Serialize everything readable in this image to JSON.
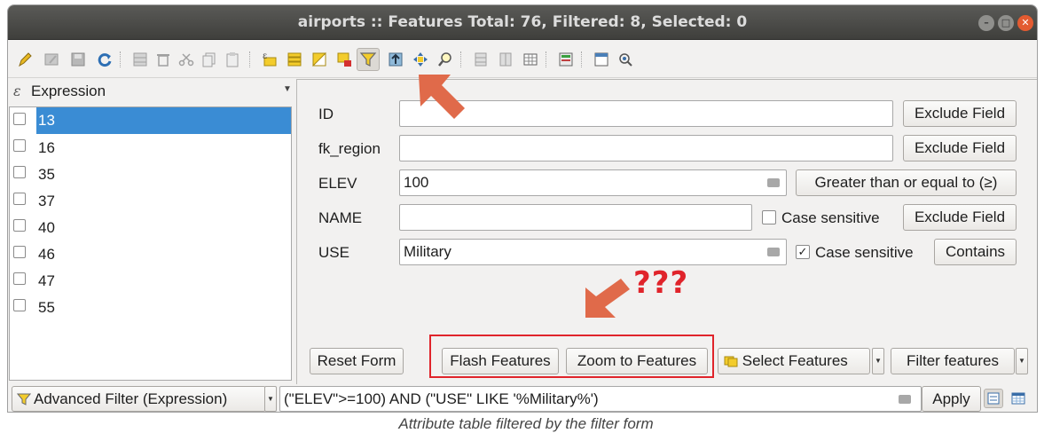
{
  "window": {
    "title": "airports :: Features Total: 76, Filtered: 8, Selected: 0",
    "controls": {
      "minimize": "–",
      "maximize": "□",
      "close": "✕"
    }
  },
  "toolbar": {
    "icons": [
      "pencil-icon",
      "multi-edit-icon",
      "save-icon",
      "reload-icon",
      "add-feature-icon",
      "delete-icon",
      "cut-icon",
      "copy-icon",
      "paste-icon",
      "expression-select-icon",
      "select-all-icon",
      "invert-selection-icon",
      "deselect-icon",
      "filter-form-icon",
      "move-top-icon",
      "pan-icon",
      "zoom-icon",
      "copy-cells-icon",
      "paste-cells-icon",
      "new-field-icon",
      "field-calculator-icon",
      "conditional-format-icon",
      "actions-icon",
      "dock-icon"
    ]
  },
  "left_panel": {
    "header_label": "Expression",
    "items": [
      "13",
      "16",
      "35",
      "37",
      "40",
      "46",
      "47",
      "55"
    ],
    "selected_index": 0
  },
  "form": {
    "rows": [
      {
        "label": "ID",
        "value": "",
        "button": "Exclude Field"
      },
      {
        "label": "fk_region",
        "value": "",
        "button": "Exclude Field"
      },
      {
        "label": "ELEV",
        "value": "100",
        "button": "Greater than or equal to (≥)"
      },
      {
        "label": "NAME",
        "value": "",
        "checkbox_label": "Case sensitive",
        "checked": false,
        "button": "Exclude Field"
      },
      {
        "label": "USE",
        "value": "Military",
        "checkbox_label": "Case sensitive",
        "checked": true,
        "button": "Contains"
      }
    ],
    "buttons": {
      "reset": "Reset Form",
      "flash": "Flash Features",
      "zoom": "Zoom to Features",
      "select": "Select Features",
      "filter": "Filter features"
    }
  },
  "bottom": {
    "filter_mode": "Advanced Filter (Expression)",
    "expression": "(\"ELEV\">=100) AND (\"USE\" LIKE '%Military%')",
    "apply_label": "Apply"
  },
  "annotations": {
    "question_marks": "???",
    "color": "#e0242b",
    "arrow_color": "#e06a4a"
  },
  "caption": "Attribute table filtered by the filter form"
}
